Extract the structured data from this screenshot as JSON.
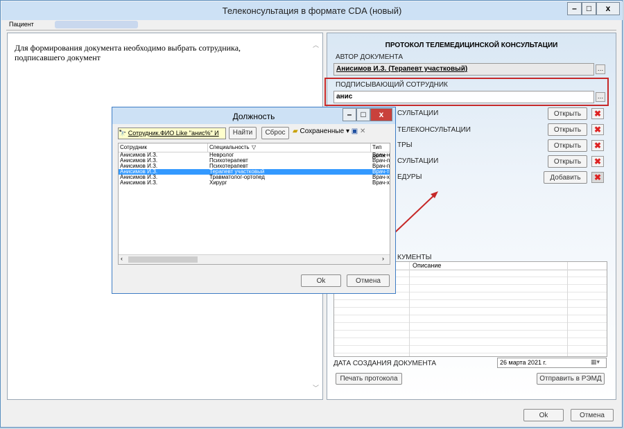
{
  "window": {
    "title": "Телеконсультация в формате CDA (новый)"
  },
  "patient": {
    "label": "Пациент"
  },
  "info": {
    "line1": "Для формирования документа необходимо выбрать сотрудника,",
    "line2": "подписавшего документ"
  },
  "protocol": {
    "heading": "ПРОТОКОЛ ТЕЛЕМЕДИЦИНСКОЙ КОНСУЛЬТАЦИИ",
    "author_label": "АВТОР ДОКУМЕНТА",
    "author_value": "Анисимов И.З. (Терапевт участковый)",
    "signer_label": "ПОДПИСЫВАЮЩИЙ СОТРУДНИК",
    "signer_value": "анис",
    "sections": [
      {
        "label": "СУЛЬТАЦИИ",
        "button": "Открыть"
      },
      {
        "label": "ТЕЛЕКОНСУЛЬТАЦИИ",
        "button": "Открыть"
      },
      {
        "label": "ТРЫ",
        "button": "Открыть"
      },
      {
        "label": "СУЛЬТАЦИИ",
        "button": "Открыть"
      },
      {
        "label": "ЕДУРЫ",
        "button": "Добавить"
      }
    ],
    "docs_label": "КУМЕНТЫ",
    "docs_col_desc": "Описание",
    "date_label": "ДАТА СОЗДАНИЯ ДОКУМЕНТА",
    "date_value": "26  марта  2021 г.",
    "print_btn": "Печать протокола",
    "send_btn": "Отправить в РЭМД"
  },
  "footer": {
    "ok": "Ok",
    "cancel": "Отмена"
  },
  "dialog": {
    "title": "Должность",
    "filter_text": "Сотрудник.ФИО  Like  \"анис%\"  И",
    "find_btn": "Найти",
    "reset_btn": "Сброс",
    "saved_btn": "Сохраненные",
    "columns": [
      "Сотрудник",
      "Специальность",
      "Тип долж"
    ],
    "rows": [
      {
        "employee": "Анисимов И.З.",
        "specialty": "Невролог",
        "type": "Врач-невр"
      },
      {
        "employee": "Анисимов И.З.",
        "specialty": "Психотерапевт",
        "type": "Врач-псих"
      },
      {
        "employee": "Анисимов И.З.",
        "specialty": "Психотерапевт",
        "type": "Врач-псих"
      },
      {
        "employee": "Анисимов И.З.",
        "specialty": "Терапевт участковый",
        "type": "Врач-тера"
      },
      {
        "employee": "Анисимов И.З.",
        "specialty": "Травматолог-ортопед",
        "type": "Врач-хир"
      },
      {
        "employee": "Анисимов И.З.",
        "specialty": "Хирург",
        "type": "Врач-хир"
      }
    ],
    "selected_row": 3,
    "ok": "Ok",
    "cancel": "Отмена"
  },
  "colors": {
    "selected_row": "#3399ff",
    "highlight": "#c62828",
    "titlebar": "#cde1f5"
  }
}
